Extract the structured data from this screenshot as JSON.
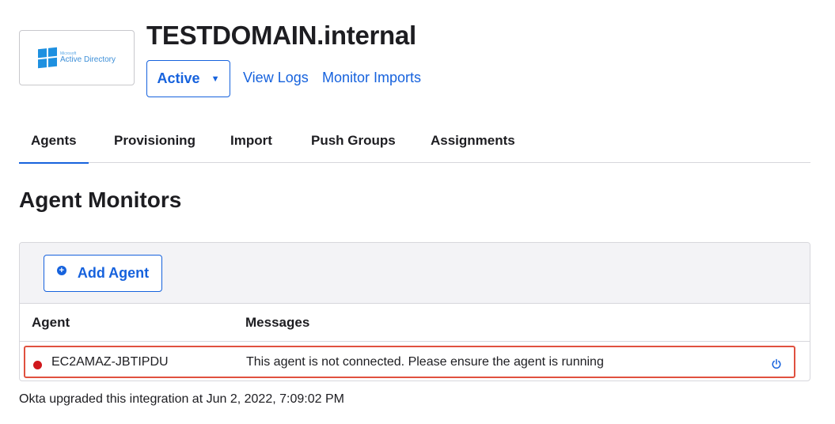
{
  "app": {
    "logo_text_small": "Microsoft",
    "logo_text": "Active Directory",
    "title": "TESTDOMAIN.internal",
    "status_label": "Active",
    "links": {
      "view_logs": "View Logs",
      "monitor_imports": "Monitor Imports"
    }
  },
  "tabs": [
    {
      "label": "Agents",
      "active": true
    },
    {
      "label": "Provisioning",
      "active": false
    },
    {
      "label": "Import",
      "active": false
    },
    {
      "label": "Push Groups",
      "active": false
    },
    {
      "label": "Assignments",
      "active": false
    }
  ],
  "section": {
    "title": "Agent Monitors"
  },
  "toolbar": {
    "add_agent_label": "Add Agent"
  },
  "table": {
    "columns": [
      "Agent",
      "Messages"
    ],
    "rows": [
      {
        "agent": "EC2AMAZ-JBTIPDU",
        "message": "This agent is not connected. Please ensure the agent is running",
        "status": "disconnected"
      }
    ]
  },
  "footer": {
    "note": "Okta upgraded this integration at Jun 2, 2022, 7:09:02 PM"
  },
  "colors": {
    "accent": "#1662dd",
    "status_error": "#d0171c",
    "highlight_border": "#e0513f"
  },
  "icons": {
    "logo": "windows-logo-icon",
    "caret": "caret-down-icon",
    "add": "plus-circle-icon",
    "power": "power-icon"
  }
}
